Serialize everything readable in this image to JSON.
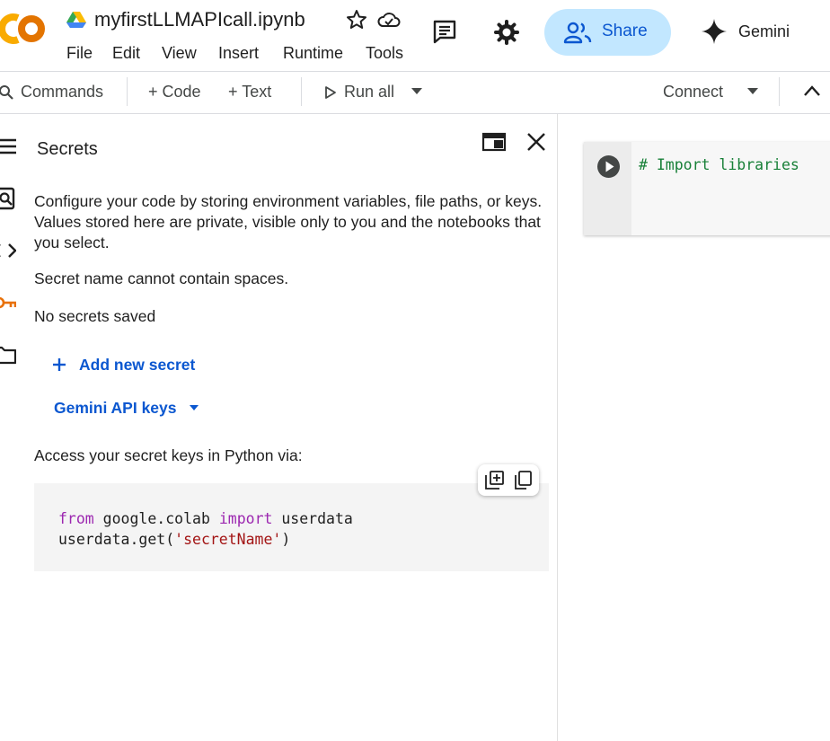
{
  "header": {
    "logo_text": "CO",
    "notebook_title": "myfirstLLMAPIcall.ipynb",
    "menu": [
      "File",
      "Edit",
      "View",
      "Insert",
      "Runtime",
      "Tools"
    ],
    "share_label": "Share",
    "gemini_label": "Gemini"
  },
  "toolbar": {
    "commands_label": "Commands",
    "code_label": "+ Code",
    "text_label": "+ Text",
    "run_all_label": "Run all",
    "connect_label": "Connect"
  },
  "secrets_panel": {
    "title": "Secrets",
    "description": "Configure your code by storing environment variables, file paths, or keys. Values stored here are private, visible only to you and the notebooks that you select.",
    "name_note": "Secret name cannot contain spaces.",
    "empty_state": "No secrets saved",
    "add_secret_label": "Add new secret",
    "gemini_keys_label": "Gemini API keys",
    "access_label": "Access your secret keys in Python via:",
    "code": {
      "line1_kw1": "from",
      "line1_mod": " google.colab ",
      "line1_kw2": "import",
      "line1_name": " userdata",
      "line2_call": "userdata.get(",
      "line2_str": "'secretName'",
      "line2_end": ")"
    }
  },
  "notebook": {
    "cell_code": "# Import libraries"
  },
  "colors": {
    "accent": "#0b57d0",
    "share_bg": "#c2e7ff",
    "logo_orange": "#f9ab00",
    "comment_green": "#188038"
  }
}
